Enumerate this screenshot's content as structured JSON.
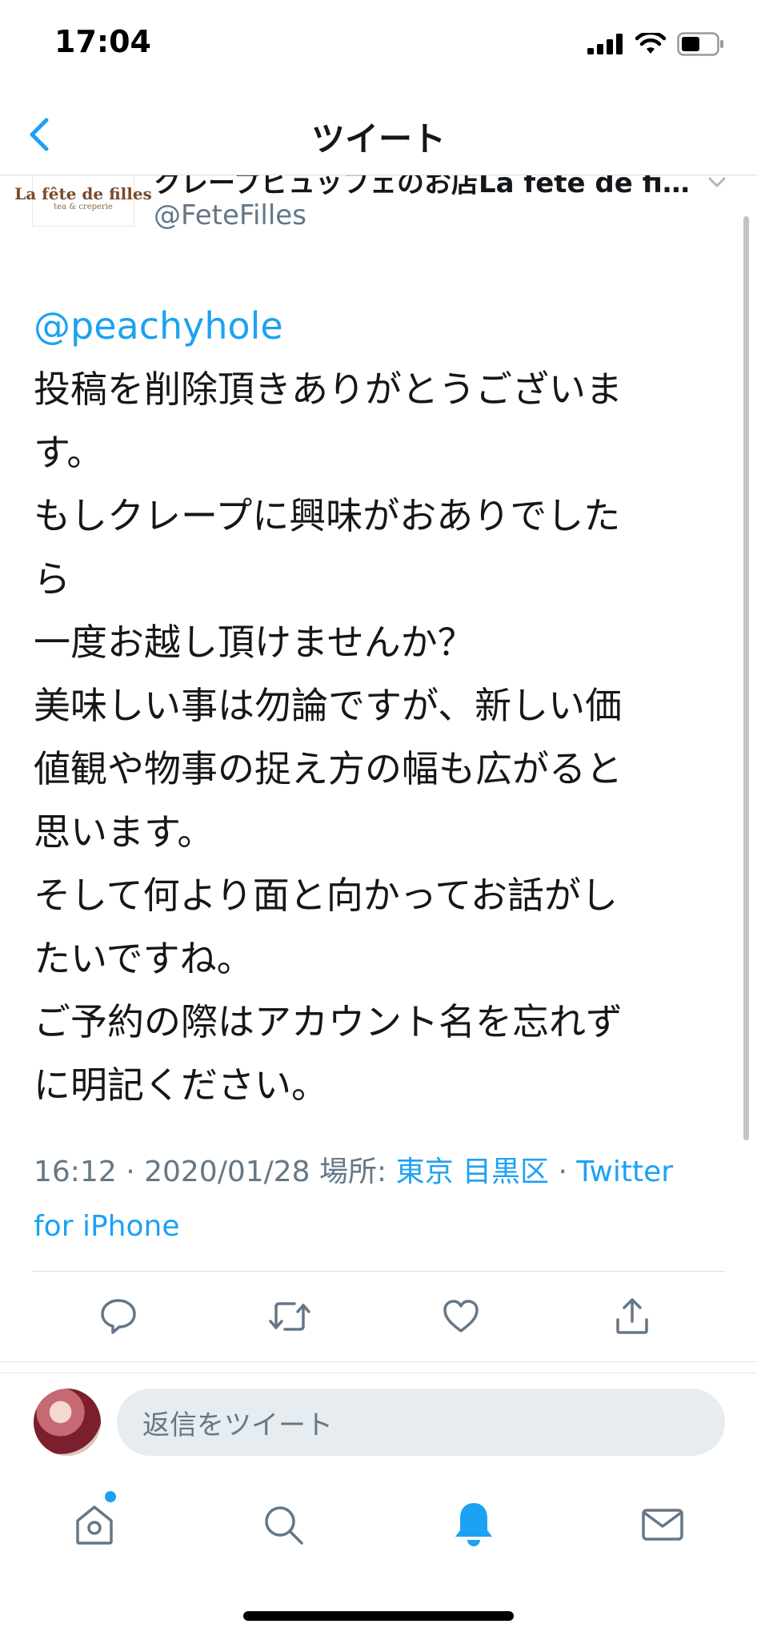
{
  "status_bar": {
    "time": "17:04"
  },
  "nav": {
    "title": "ツイート"
  },
  "author": {
    "display_name": "クレープビュッフェのお店La fete de fil...",
    "handle": "@FeteFilles",
    "logo_text": "La fête de filles",
    "logo_subtext": "tea & creperie"
  },
  "tweet": {
    "mention": "@peachyhole",
    "lines": [
      "投稿を削除頂きありがとうございま",
      "す。",
      "もしクレープに興味がおありでした",
      "ら",
      "一度お越し頂けませんか？",
      "美味しい事は勿論ですが、新しい価",
      "値観や物事の捉え方の幅も広がると",
      "思います。",
      "そして何より面と向かってお話がし",
      "たいですね。",
      "ご予約の際はアカウント名を忘れず",
      "に明記ください。"
    ]
  },
  "meta": {
    "time_date": "16:12 · 2020/01/28 ",
    "location_label": "場所: ",
    "location": "東京 目黒区",
    "separator": " · ",
    "source": "Twitter for iPhone"
  },
  "actions": [
    "reply-icon",
    "retweet-icon",
    "like-icon",
    "share-icon"
  ],
  "reply": {
    "placeholder": "返信をツイート"
  },
  "tabs": [
    "home-icon",
    "search-icon",
    "notifications-icon",
    "messages-icon"
  ],
  "colors": {
    "accent": "#1da1f2",
    "secondary_text": "#657786",
    "active_tab": "#1da1f2",
    "inactive_icon": "#657786"
  }
}
